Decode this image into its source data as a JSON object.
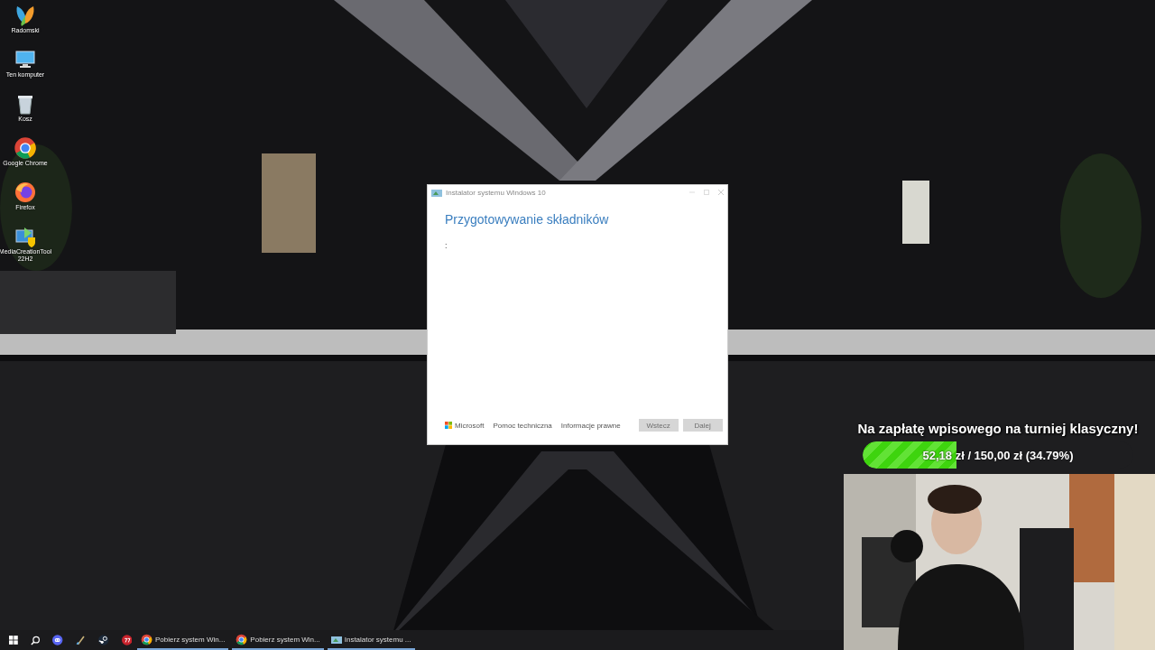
{
  "desktop_icons": [
    {
      "kind": "user",
      "label": "Radomski"
    },
    {
      "kind": "computer",
      "label": "Ten komputer"
    },
    {
      "kind": "bin",
      "label": "Kosz"
    },
    {
      "kind": "chrome",
      "label": "Google Chrome"
    },
    {
      "kind": "firefox",
      "label": "Firefox"
    },
    {
      "kind": "tool",
      "label": "MediaCreationTool 22H2"
    }
  ],
  "window": {
    "title": "Instalator systemu Windows 10",
    "heading": "Przygotowywanie składników",
    "status": ":",
    "brand": "Microsoft",
    "links": [
      "Pomoc techniczna",
      "Informacje prawne"
    ],
    "buttons": [
      {
        "label": "Wstecz",
        "disabled": true
      },
      {
        "label": "Dalej",
        "disabled": true
      }
    ]
  },
  "overlay": {
    "goal_title": "Na zapłatę wpisowego na turniej klasyczny!",
    "level": 0.3479,
    "reading": "52,18 zł / 150,00 zł (34.79%)"
  },
  "taskbar": {
    "pinned": [
      {
        "kind": "start"
      },
      {
        "kind": "search"
      },
      {
        "kind": "discord"
      },
      {
        "kind": "brush"
      },
      {
        "kind": "steam"
      },
      {
        "kind": "red"
      }
    ],
    "tasks": [
      {
        "kind": "chrome",
        "label": "Pobierz system Win..."
      },
      {
        "kind": "chrome",
        "label": "Pobierz system Win..."
      },
      {
        "kind": "installer",
        "label": "Instalator systemu ..."
      }
    ]
  }
}
